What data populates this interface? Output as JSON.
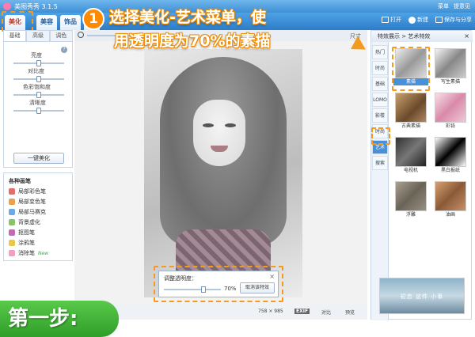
{
  "window": {
    "title": "美图秀秀 3.1.5",
    "menu": "菜单",
    "feedback": "提意见"
  },
  "main_tabs": [
    "美化",
    "美容",
    "饰品",
    "文字"
  ],
  "toolbar": {
    "open": "打开",
    "new": "新建",
    "save_share": "保存与分享"
  },
  "left": {
    "subtabs": [
      "基础",
      "高级",
      "调色"
    ],
    "sliders": [
      {
        "label": "亮度",
        "value": 0.5
      },
      {
        "label": "对比度",
        "value": 0.5
      },
      {
        "label": "色彩饱和度",
        "value": 0.5
      },
      {
        "label": "清晰度",
        "value": 0.5
      }
    ],
    "one_key": "一键美化",
    "brush_title": "各种画笔",
    "brushes": [
      "局部彩色笔",
      "局部变色笔",
      "局部马赛克",
      "背景虚化",
      "抠图笔",
      "涂鸦笔",
      "消除笔"
    ],
    "new_badge": "New"
  },
  "canvas": {
    "size_label": "尺寸",
    "adjust": {
      "label": "调整透明度：",
      "value_text": "70%",
      "value": 0.7,
      "cancel": "取消该特效",
      "close": "×"
    },
    "dimensions": "758 × 985",
    "exif": "EXIF",
    "compare": "对比",
    "preview": "预览"
  },
  "right": {
    "header": "特效展示 > 艺术特效",
    "close": "×",
    "categories": [
      "热门",
      "时尚",
      "基础",
      "LOMO",
      "影楼",
      "时尚",
      "艺术",
      "搜索"
    ],
    "active_category": "艺术",
    "effects": [
      "素描",
      "写生素描",
      "古典素描",
      "彩铅",
      "电视机",
      "黑白报纸",
      "浮雕",
      "油画"
    ],
    "selected_effect": "素描",
    "banner": "初恋 这件 小事"
  },
  "callout": {
    "number": "1",
    "line1": "选择美化-艺术菜单，使",
    "line2": "用透明度为70%的素描"
  },
  "step": "第一步:",
  "colors": {
    "accent": "#f39a1f",
    "title_blue": "#3d8fd6",
    "green": "#3aa84a"
  }
}
